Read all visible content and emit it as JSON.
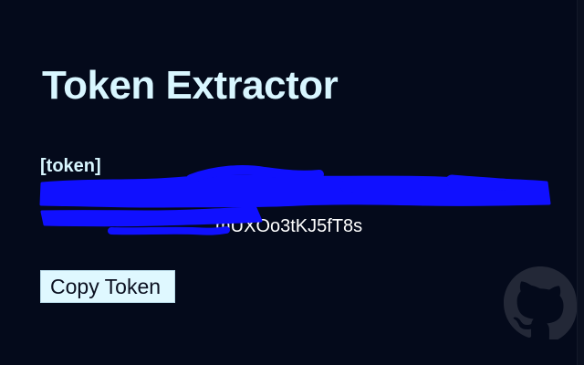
{
  "app": {
    "title": "Token Extractor"
  },
  "token_section": {
    "label": "[token]",
    "value_visible_tail": "mUXOo3tKJ5fT8s"
  },
  "actions": {
    "copy_label": "Copy Token"
  },
  "icons": {
    "github": "github-icon"
  },
  "colors": {
    "background": "#050b1a",
    "title": "#d8f6ff",
    "redaction": "#1010ff",
    "button_bg": "#dff8ff",
    "button_text": "#0b1020"
  }
}
